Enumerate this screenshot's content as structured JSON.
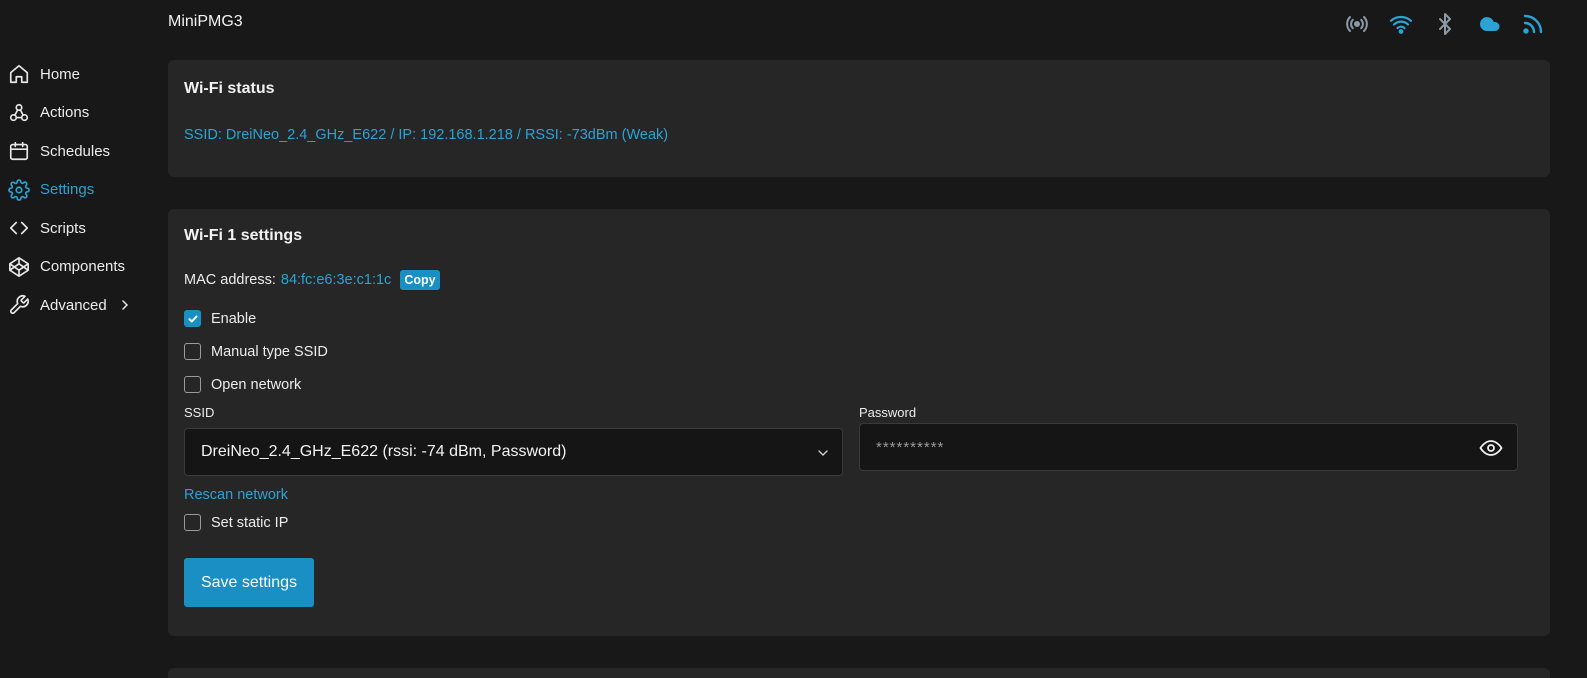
{
  "app": {
    "title": "MiniPMG3"
  },
  "status_icons": [
    {
      "name": "broadcast-icon",
      "color": "#8a9aa6"
    },
    {
      "name": "wifi-icon",
      "color": "#2ba3d4"
    },
    {
      "name": "bluetooth-icon",
      "color": "#8a9aa6"
    },
    {
      "name": "cloud-icon",
      "color": "#2ba3d4"
    },
    {
      "name": "rss-icon",
      "color": "#2ba3d4"
    }
  ],
  "sidebar": {
    "items": [
      {
        "label": "Home",
        "icon": "home-icon"
      },
      {
        "label": "Actions",
        "icon": "webhook-icon"
      },
      {
        "label": "Schedules",
        "icon": "calendar-icon"
      },
      {
        "label": "Settings",
        "icon": "gear-icon",
        "active": true
      },
      {
        "label": "Scripts",
        "icon": "code-icon"
      },
      {
        "label": "Components",
        "icon": "codepen-icon"
      },
      {
        "label": "Advanced",
        "icon": "wrench-icon",
        "has_submenu": true
      }
    ]
  },
  "wifi_status": {
    "title": "Wi-Fi status",
    "line": "SSID: DreiNeo_2.4_GHz_E622 / IP: 192.168.1.218 / RSSI: -73dBm (Weak)"
  },
  "wifi1": {
    "title": "Wi-Fi 1 settings",
    "mac_label": "MAC address:",
    "mac_value": "84:fc:e6:3e:c1:1c",
    "copy_label": "Copy",
    "checkboxes": {
      "enable": {
        "label": "Enable",
        "checked": true
      },
      "manual_ssid": {
        "label": "Manual type SSID",
        "checked": false
      },
      "open_network": {
        "label": "Open network",
        "checked": false
      },
      "static_ip": {
        "label": "Set static IP",
        "checked": false
      }
    },
    "ssid_label": "SSID",
    "ssid_selected": "DreiNeo_2.4_GHz_E622 (rssi: -74 dBm, Password)",
    "password_label": "Password",
    "password_value": "**********",
    "rescan_label": "Rescan network",
    "save_label": "Save settings"
  },
  "colors": {
    "accent": "#1a8fc4",
    "link": "#2ba3d4",
    "card": "#262626",
    "background": "#181818"
  }
}
